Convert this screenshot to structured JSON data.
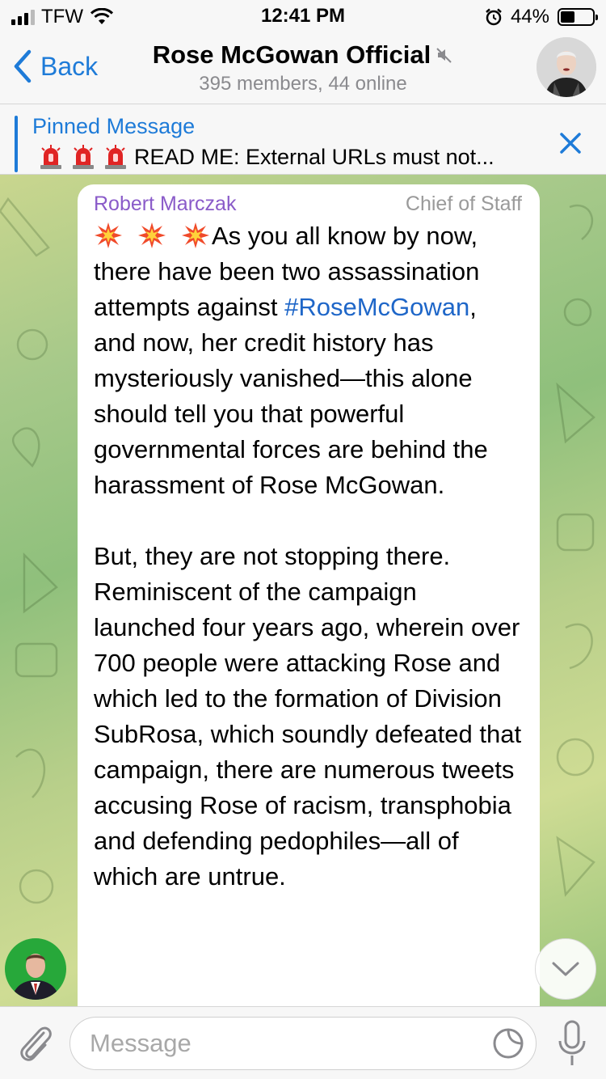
{
  "status_bar": {
    "carrier": "TFW",
    "time": "12:41 PM",
    "battery_percent": "44%",
    "battery_level": 0.44,
    "signal_bars": 3
  },
  "header": {
    "back_label": "Back",
    "title": "Rose McGowan Official",
    "subtitle": "395 members, 44 online"
  },
  "pinned": {
    "label": "Pinned Message",
    "text": "READ ME: External URLs must not..."
  },
  "message": {
    "sender": "Robert Marczak",
    "role": "Chief of Staff",
    "text_before_tag": "As you all know by now, there have been two assassination attempts against ",
    "hashtag": "#RoseMcGowan",
    "text_after_tag": ", and now, her credit history has mysteriously vanished—this alone should tell you that powerful governmental forces are behind the harassment of Rose McGowan.\n\nBut, they are not stopping there. Reminiscent of the campaign launched four years ago, wherein over 700 people were attacking Rose and which led to the formation of Division SubRosa, which soundly defeated that campaign, there are numerous tweets accusing Rose of racism, transphobia and defending pedophiles—all of which are untrue."
  },
  "input": {
    "placeholder": "Message",
    "value": ""
  },
  "colors": {
    "accent": "#1e7bd8",
    "sender_name": "#8a5bc9",
    "hashtag": "#1e66c8"
  }
}
